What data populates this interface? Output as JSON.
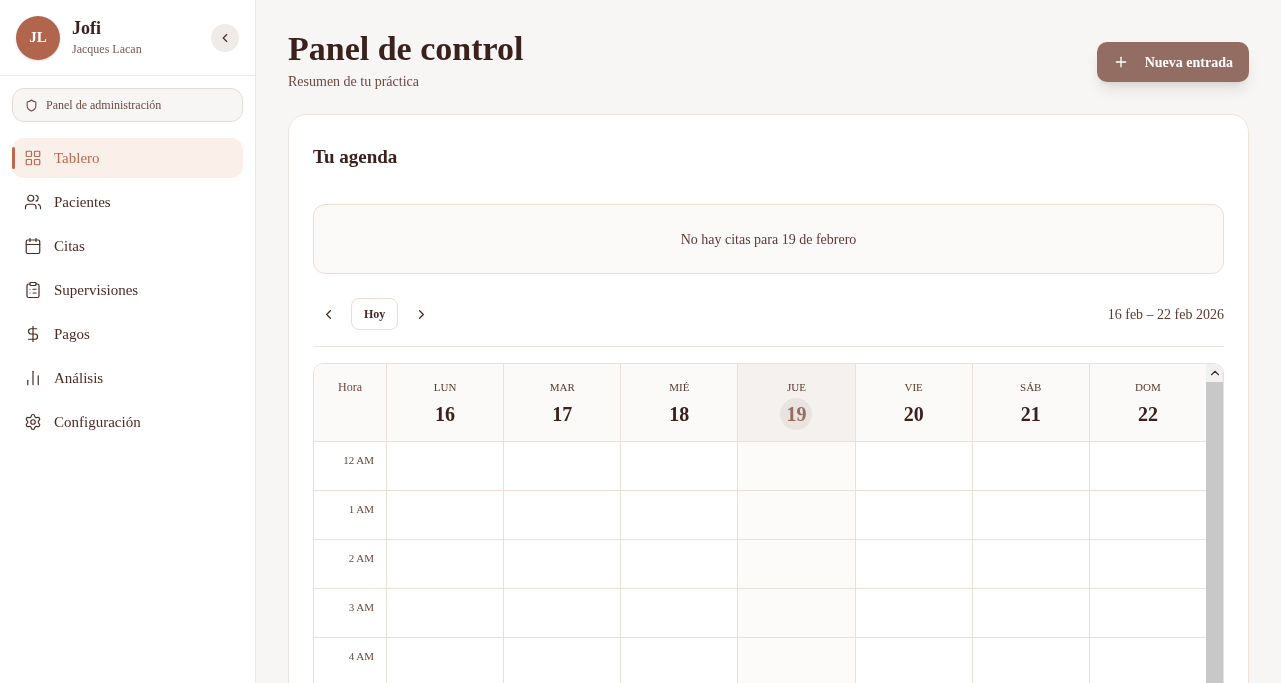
{
  "sidebar": {
    "user": {
      "initials": "JL",
      "name": "Jofi",
      "subtitle": "Jacques Lacan"
    },
    "admin_button": "Panel de administración",
    "items": [
      {
        "label": "Tablero",
        "kind": "dashboard",
        "selected": true
      },
      {
        "label": "Pacientes",
        "kind": "users",
        "selected": false
      },
      {
        "label": "Citas",
        "kind": "calendar",
        "selected": false
      },
      {
        "label": "Supervisiones",
        "kind": "clipboard",
        "selected": false
      },
      {
        "label": "Pagos",
        "kind": "dollar",
        "selected": false
      },
      {
        "label": "Análisis",
        "kind": "chart",
        "selected": false
      },
      {
        "label": "Configuración",
        "kind": "settings",
        "selected": false
      }
    ]
  },
  "header": {
    "title": "Panel de control",
    "subtitle": "Resumen de tu práctica",
    "action_button": "Nueva entrada"
  },
  "agenda": {
    "title": "Tu agenda",
    "empty_message": "No hay citas para 19 de febrero",
    "today_button": "Hoy",
    "range": "16 feb – 22 feb 2026",
    "hour_heading": "Hora",
    "days": [
      {
        "weekday": "LUN",
        "date": "16",
        "selected": false
      },
      {
        "weekday": "MAR",
        "date": "17",
        "selected": false
      },
      {
        "weekday": "MIÉ",
        "date": "18",
        "selected": false
      },
      {
        "weekday": "JUE",
        "date": "19",
        "selected": true
      },
      {
        "weekday": "VIE",
        "date": "20",
        "selected": false
      },
      {
        "weekday": "SÁB",
        "date": "21",
        "selected": false
      },
      {
        "weekday": "DOM",
        "date": "22",
        "selected": false
      }
    ],
    "hours": [
      "12 AM",
      "1 AM",
      "2 AM",
      "3 AM",
      "4 AM"
    ]
  }
}
